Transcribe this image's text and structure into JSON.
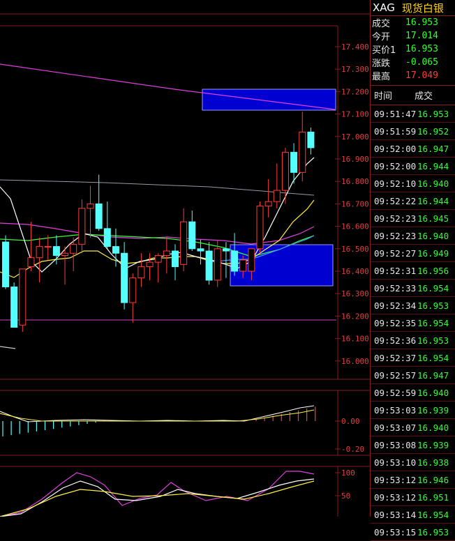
{
  "header": {
    "symbol": "XAG",
    "name": "现货白银"
  },
  "quote": [
    {
      "label": "成交",
      "value": "16.953",
      "color": "green"
    },
    {
      "label": "今开",
      "value": "17.014",
      "color": "green"
    },
    {
      "label": "买价1",
      "value": "16.953",
      "color": "green"
    },
    {
      "label": "涨跌",
      "value": "-0.065",
      "color": "green"
    },
    {
      "label": "最高",
      "value": "17.049",
      "color": "red"
    }
  ],
  "trades_header": {
    "time": "时间",
    "price": "成交"
  },
  "trades": [
    {
      "time": "09:51:47",
      "price": "16.953"
    },
    {
      "time": "09:51:59",
      "price": "16.952"
    },
    {
      "time": "09:52:00",
      "price": "16.947"
    },
    {
      "time": "09:52:00",
      "price": "16.944"
    },
    {
      "time": "09:52:10",
      "price": "16.940"
    },
    {
      "time": "09:52:22",
      "price": "16.944"
    },
    {
      "time": "09:52:23",
      "price": "16.945"
    },
    {
      "time": "09:52:23",
      "price": "16.940"
    },
    {
      "time": "09:52:27",
      "price": "16.949"
    },
    {
      "time": "09:52:31",
      "price": "16.956"
    },
    {
      "time": "09:52:33",
      "price": "16.954"
    },
    {
      "time": "09:52:34",
      "price": "16.953"
    },
    {
      "time": "09:52:35",
      "price": "16.954"
    },
    {
      "time": "09:52:36",
      "price": "16.953"
    },
    {
      "time": "09:52:37",
      "price": "16.954"
    },
    {
      "time": "09:52:57",
      "price": "16.947"
    },
    {
      "time": "09:52:59",
      "price": "16.940"
    },
    {
      "time": "09:53:03",
      "price": "16.939"
    },
    {
      "time": "09:53:07",
      "price": "16.940"
    },
    {
      "time": "09:53:08",
      "price": "16.939"
    },
    {
      "time": "09:53:10",
      "price": "16.938"
    },
    {
      "time": "09:53:12",
      "price": "16.946"
    },
    {
      "time": "09:53:12",
      "price": "16.951"
    },
    {
      "time": "09:53:14",
      "price": "16.954"
    },
    {
      "time": "09:53:15",
      "price": "16.953"
    }
  ],
  "axes": {
    "price_ticks": [
      "17.400",
      "17.300",
      "17.200",
      "17.100",
      "17.000",
      "16.900",
      "16.800",
      "16.700",
      "16.600",
      "16.500",
      "16.400",
      "16.300",
      "16.200",
      "16.100",
      "16.000"
    ],
    "macd_ticks": [
      "0.00",
      "-0.20"
    ],
    "kdj_ticks": [
      "100",
      "50"
    ]
  },
  "colors": {
    "up": "#ff3b3b",
    "down": "#54ffff",
    "grid": "#8a1c1c",
    "zone": "#0000d0"
  },
  "candles": [
    {
      "o": 16.53,
      "h": 16.56,
      "l": 16.32,
      "c": 16.33
    },
    {
      "o": 16.33,
      "h": 16.35,
      "l": 16.15,
      "c": 16.15
    },
    {
      "o": 16.16,
      "h": 16.41,
      "l": 16.13,
      "c": 16.41
    },
    {
      "o": 16.42,
      "h": 16.62,
      "l": 16.4,
      "c": 16.46
    },
    {
      "o": 16.46,
      "h": 16.55,
      "l": 16.35,
      "c": 16.51
    },
    {
      "o": 16.51,
      "h": 16.56,
      "l": 16.45,
      "c": 16.51
    },
    {
      "o": 16.51,
      "h": 16.56,
      "l": 16.43,
      "c": 16.47
    },
    {
      "o": 16.47,
      "h": 16.51,
      "l": 16.34,
      "c": 16.48
    },
    {
      "o": 16.48,
      "h": 16.55,
      "l": 16.4,
      "c": 16.52
    },
    {
      "o": 16.52,
      "h": 16.72,
      "l": 16.48,
      "c": 16.68
    },
    {
      "o": 16.68,
      "h": 16.78,
      "l": 16.55,
      "c": 16.7
    },
    {
      "o": 16.7,
      "h": 16.83,
      "l": 16.58,
      "c": 16.59
    },
    {
      "o": 16.59,
      "h": 16.71,
      "l": 16.5,
      "c": 16.51
    },
    {
      "o": 16.51,
      "h": 16.59,
      "l": 16.42,
      "c": 16.48
    },
    {
      "o": 16.48,
      "h": 16.53,
      "l": 16.23,
      "c": 16.26
    },
    {
      "o": 16.26,
      "h": 16.39,
      "l": 16.17,
      "c": 16.37
    },
    {
      "o": 16.37,
      "h": 16.48,
      "l": 16.33,
      "c": 16.42
    },
    {
      "o": 16.42,
      "h": 16.48,
      "l": 16.36,
      "c": 16.44
    },
    {
      "o": 16.44,
      "h": 16.48,
      "l": 16.35,
      "c": 16.47
    },
    {
      "o": 16.47,
      "h": 16.55,
      "l": 16.39,
      "c": 16.49
    },
    {
      "o": 16.49,
      "h": 16.52,
      "l": 16.36,
      "c": 16.42
    },
    {
      "o": 16.43,
      "h": 16.68,
      "l": 16.4,
      "c": 16.62
    },
    {
      "o": 16.62,
      "h": 16.67,
      "l": 16.49,
      "c": 16.5
    },
    {
      "o": 16.5,
      "h": 16.54,
      "l": 16.43,
      "c": 16.49
    },
    {
      "o": 16.49,
      "h": 16.53,
      "l": 16.34,
      "c": 16.36
    },
    {
      "o": 16.36,
      "h": 16.54,
      "l": 16.33,
      "c": 16.5
    },
    {
      "o": 16.5,
      "h": 16.53,
      "l": 16.37,
      "c": 16.49
    },
    {
      "o": 16.49,
      "h": 16.57,
      "l": 16.38,
      "c": 16.4
    },
    {
      "o": 16.4,
      "h": 16.47,
      "l": 16.37,
      "c": 16.45
    },
    {
      "o": 16.4,
      "h": 16.5,
      "l": 16.36,
      "c": 16.5
    },
    {
      "o": 16.5,
      "h": 16.71,
      "l": 16.48,
      "c": 16.69
    },
    {
      "o": 16.69,
      "h": 16.81,
      "l": 16.64,
      "c": 16.71
    },
    {
      "o": 16.71,
      "h": 16.88,
      "l": 16.68,
      "c": 16.76
    },
    {
      "o": 16.76,
      "h": 16.95,
      "l": 16.7,
      "c": 16.93
    },
    {
      "o": 16.93,
      "h": 16.97,
      "l": 16.79,
      "c": 16.84
    },
    {
      "o": 16.84,
      "h": 17.11,
      "l": 16.8,
      "c": 17.02
    },
    {
      "o": 17.02,
      "h": 17.04,
      "l": 16.92,
      "c": 16.95
    }
  ]
}
